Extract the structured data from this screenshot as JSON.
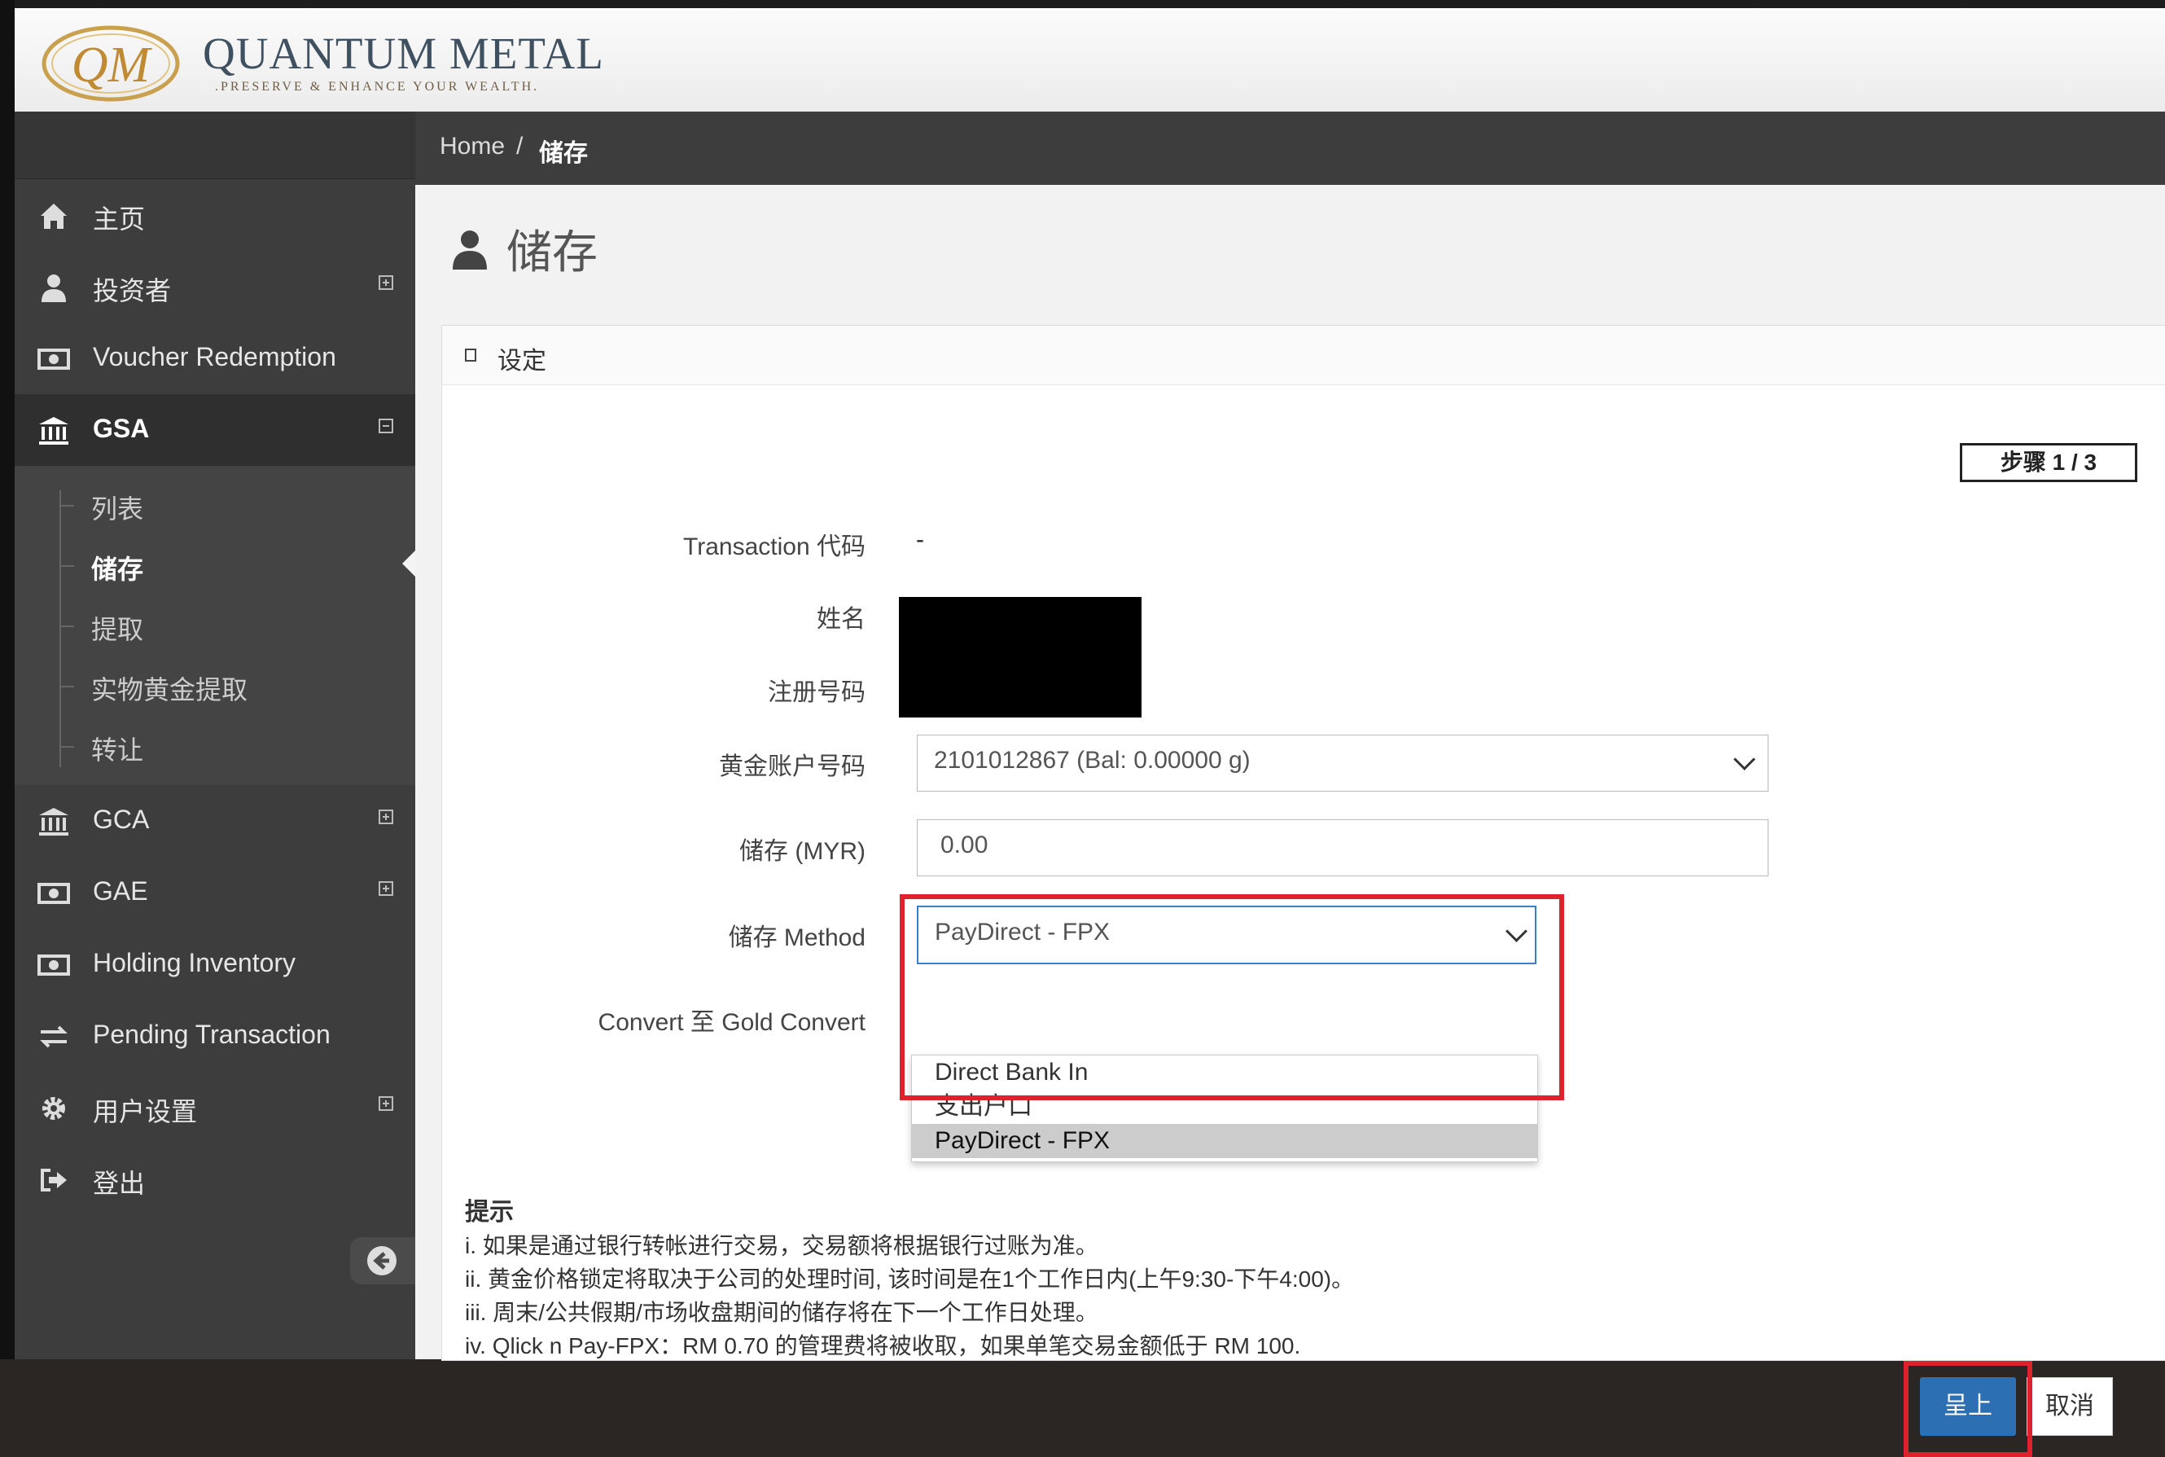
{
  "brand": {
    "name": "QUANTUM METAL",
    "tagline": ".PRESERVE & ENHANCE YOUR WEALTH.",
    "logo_letters": "QM"
  },
  "sidebar": {
    "items": [
      {
        "label": "主页",
        "icon": "home-icon"
      },
      {
        "label": "投资者",
        "icon": "user-icon"
      },
      {
        "label": "Voucher Redemption",
        "icon": "money-icon"
      },
      {
        "label": "GSA",
        "icon": "bank-icon"
      },
      {
        "label": "GCA",
        "icon": "bank-icon"
      },
      {
        "label": "GAE",
        "icon": "money-icon"
      },
      {
        "label": "Holding Inventory",
        "icon": "money-icon"
      },
      {
        "label": "Pending Transaction",
        "icon": "exchange-icon"
      },
      {
        "label": "用户设置",
        "icon": "gear-icon"
      },
      {
        "label": "登出",
        "icon": "logout-icon"
      }
    ],
    "gsa_sub": [
      "列表",
      "储存",
      "提取",
      "实物黄金提取",
      "转让"
    ]
  },
  "breadcrumb": {
    "home": "Home",
    "sep": "/",
    "current": "储存"
  },
  "page_title": "储存",
  "panel": {
    "title": "设定",
    "step": "步骤 1 / 3",
    "labels": {
      "transaction_code": "Transaction 代码",
      "name": "姓名",
      "reg_no": "注册号码",
      "gold_account": "黄金账户号码",
      "deposit": "储存 (MYR)",
      "method": "储存 Method",
      "convert": "Convert 至 Gold Convert"
    },
    "transaction_code_value": "-",
    "gold_account_value": "2101012867 (Bal: 0.00000 g)",
    "deposit_value": "0.00",
    "method_value": "PayDirect - FPX",
    "method_options": [
      "Direct Bank In",
      "支出户口",
      "PayDirect - FPX"
    ]
  },
  "hints": {
    "title": "提示",
    "lines": [
      "i. 如果是通过银行转帐进行交易，交易额将根据银行过账为准。",
      "ii. 黄金价格锁定将取决于公司的处理时间, 该时间是在1个工作日内(上午9:30-下午4:00)。",
      "iii. 周末/公共假期/市场收盘期间的储存将在下一个工作日处理。",
      "iv. Qlick n Pay-FPX：RM 0.70 的管理费将被收取，如果单笔交易金额低于 RM 100."
    ]
  },
  "buttons": {
    "submit": "呈上",
    "cancel": "取消"
  },
  "colors": {
    "highlight": "#e0202a",
    "primary": "#2c6fb3",
    "sidebar": "#3d3d3d"
  }
}
